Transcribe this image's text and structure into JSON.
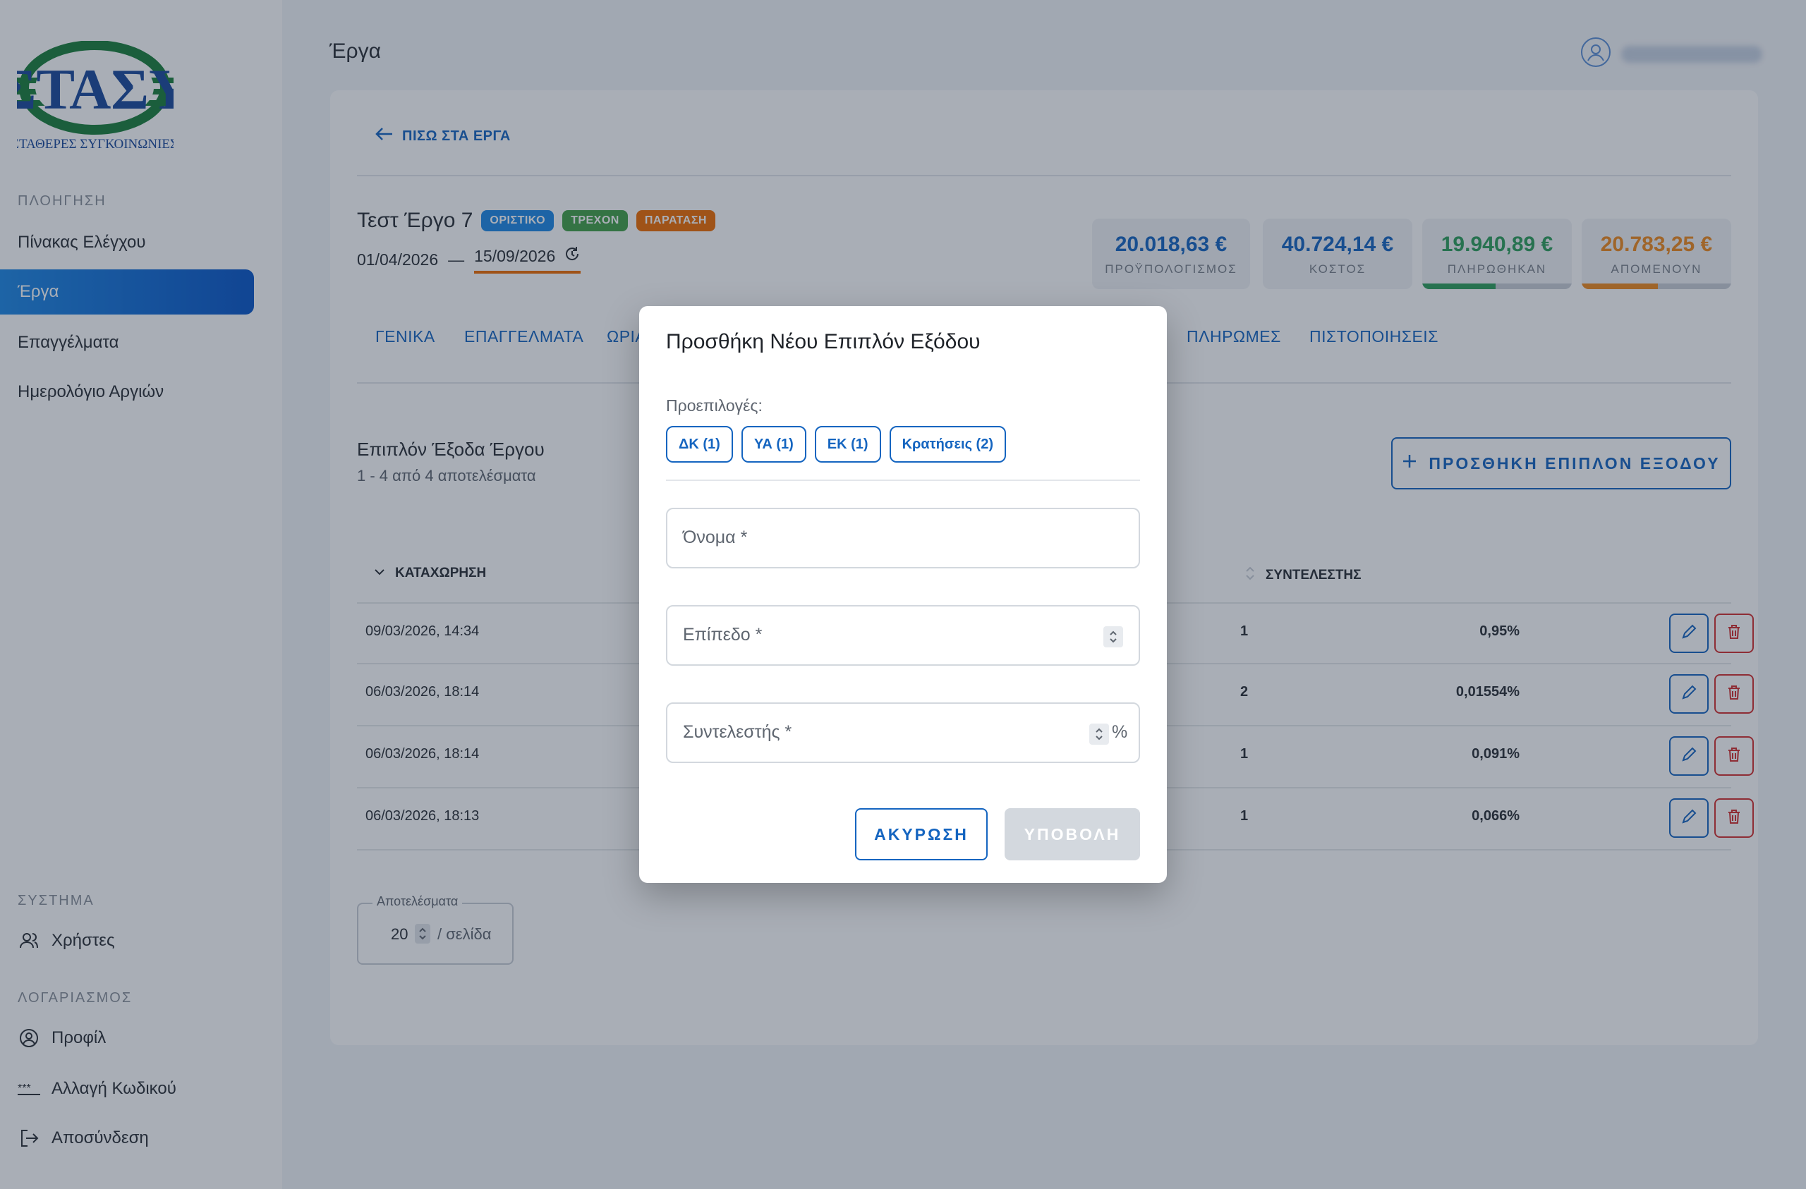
{
  "colors": {
    "accent": "#1565c0",
    "nav_active": "#0a56c7",
    "chip_final": "#1e88e5",
    "chip_current": "#43a047",
    "chip_extension": "#ef6c00",
    "stat_budget": "#1565c0",
    "stat_cost": "#1565c0",
    "stat_paid": "#2e9e5b",
    "stat_remaining": "#ef8a1d",
    "danger": "#d32f2f",
    "disabled": "#d3d8de"
  },
  "sidebar": {
    "logo_text": "ΣΤΑΣΥ",
    "logo_subtext": "ΣΤΑΘΕΡΕΣ ΣΥΓΚΟΙΝΩΝΙΕΣ",
    "nav_section": "ΠΛΟΗΓΗΣΗ",
    "nav_items": [
      {
        "label": "Πίνακας Ελέγχου"
      },
      {
        "label": "Έργα",
        "active": true
      },
      {
        "label": "Επαγγέλματα"
      },
      {
        "label": "Ημερολόγιο Αργιών"
      }
    ],
    "system_section": "ΣΥΣΤΗΜΑ",
    "system_items": [
      {
        "label": "Χρήστες",
        "icon": "users-icon"
      }
    ],
    "account_section": "ΛΟΓΑΡΙΑΣΜΟΣ",
    "account_items": [
      {
        "label": "Προφίλ",
        "icon": "profile-icon"
      },
      {
        "label": "Αλλαγή Κωδικού",
        "icon": "password-icon"
      },
      {
        "label": "Αποσύνδεση",
        "icon": "logout-icon"
      }
    ]
  },
  "header": {
    "title": "Έργα"
  },
  "project": {
    "back_label": "ΠΙΣΩ ΣΤΑ ΕΡΓΑ",
    "title": "Τεστ Έργο 7",
    "chips": [
      "ΟΡΙΣΤΙΚΟ",
      "ΤΡΕΧΟΝ",
      "ΠΑΡΑΤΑΣΗ"
    ],
    "start_date": "01/04/2026",
    "date_separator": "—",
    "end_date": "15/09/2026",
    "stats": [
      {
        "value": "20.018,63 €",
        "label": "ΠΡΟΫΠΟΛΟΓΙΣΜΟΣ"
      },
      {
        "value": "40.724,14 €",
        "label": "ΚΟΣΤΟΣ"
      },
      {
        "value": "19.940,89 €",
        "label": "ΠΛΗΡΩΘΗΚΑΝ",
        "progress": 0.49
      },
      {
        "value": "20.783,25 €",
        "label": "ΑΠΟΜΕΝΟΥΝ",
        "progress": 0.51
      }
    ],
    "tabs": [
      "ΓΕΝΙΚΑ",
      "ΕΠΑΓΓΕΛΜΑΤΑ",
      "ΩΡΙΑ",
      "ΠΛΗΡΩΜΕΣ",
      "ΠΙΣΤΟΠΟΙΗΣΕΙΣ"
    ]
  },
  "expenses": {
    "title": "Επιπλόν Έξοδα Έργου",
    "subtitle": "1 - 4 από 4 αποτελέσματα",
    "add_label": "ΠΡΟΣΘΗΚΗ ΕΠΙΠΛΟΝ ΕΞΟΔΟΥ",
    "columns": {
      "entry": "ΚΑΤΑΧΩΡΗΣΗ",
      "factor": "ΣΥΝΤΕΛΕΣΤΗΣ"
    },
    "rows": [
      {
        "date": "09/03/2026, 14:34",
        "level": "1",
        "factor": "0,95%"
      },
      {
        "date": "06/03/2026, 18:14",
        "level": "2",
        "factor": "0,01554%"
      },
      {
        "date": "06/03/2026, 18:14",
        "level": "1",
        "factor": "0,091%"
      },
      {
        "date": "06/03/2026, 18:13",
        "level": "1",
        "factor": "0,066%"
      }
    ],
    "pager": {
      "legend": "Αποτελέσματα",
      "value": "20",
      "suffix": "/ σελίδα"
    }
  },
  "modal": {
    "title": "Προσθήκη Νέου Επιπλόν Εξόδου",
    "presets_label": "Προεπιλογές:",
    "presets": [
      "ΔΚ (1)",
      "ΥΑ (1)",
      "ΕΚ (1)",
      "Κρατήσεις (2)"
    ],
    "name_label": "Όνομα *",
    "level_label": "Επίπεδο *",
    "factor_label": "Συντελεστής *",
    "factor_suffix": "%",
    "cancel_label": "ΑΚΥΡΩΣΗ",
    "submit_label": "ΥΠΟΒΟΛΗ"
  }
}
